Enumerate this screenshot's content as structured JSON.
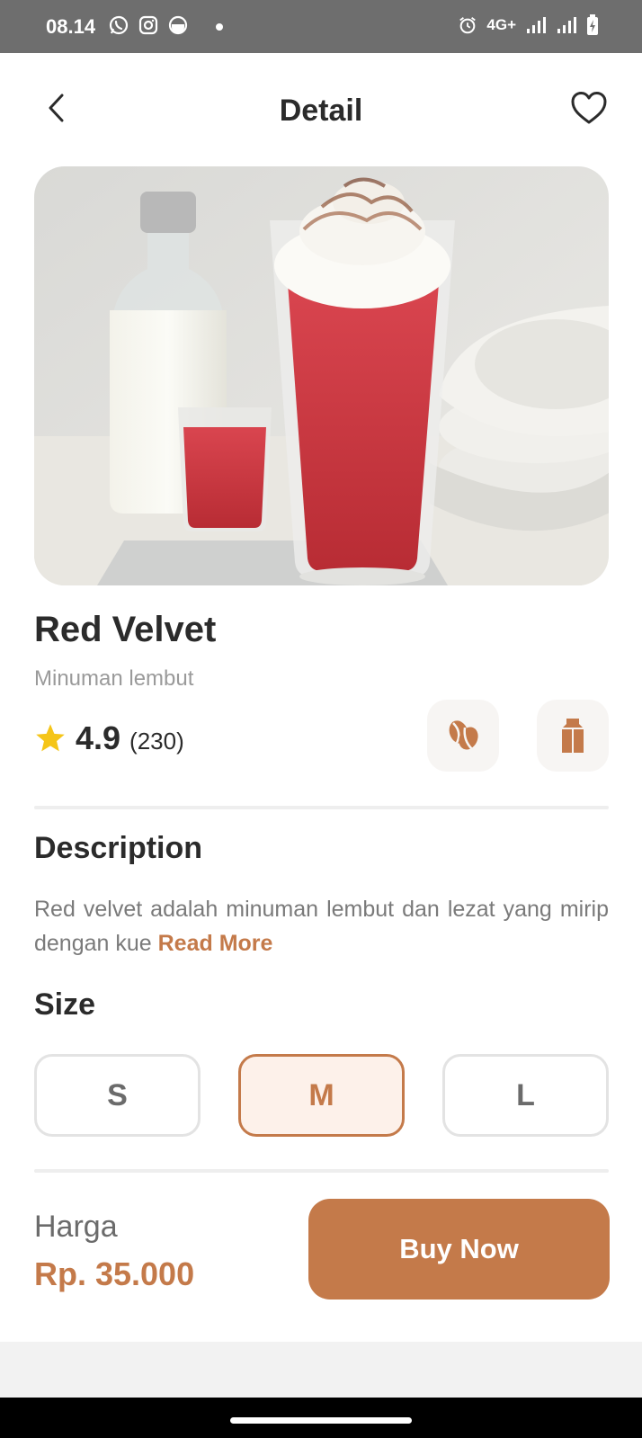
{
  "status_bar": {
    "time": "08.14",
    "network": "4G+",
    "app_icons": [
      "whatsapp-icon",
      "instagram-icon",
      "messenger-icon"
    ],
    "system_icons": [
      "alarm-icon",
      "signal-icon",
      "signal-icon",
      "battery-icon"
    ]
  },
  "header": {
    "title": "Detail",
    "back_icon": "chevron-left-icon",
    "favorite_icon": "heart-outline-icon"
  },
  "product": {
    "name": "Red Velvet",
    "subtitle": "Minuman lembut",
    "rating": "4.9",
    "rating_count": "(230)",
    "features": [
      "coffee-bean-icon",
      "milk-carton-icon"
    ]
  },
  "description": {
    "title": "Description",
    "text": "Red velvet adalah minuman lembut dan lezat yang mirip dengan kue ",
    "read_more": "Read More"
  },
  "size": {
    "title": "Size",
    "options": [
      "S",
      "M",
      "L"
    ],
    "selected": "M"
  },
  "footer": {
    "price_label": "Harga",
    "price": "Rp. 35.000",
    "buy_label": "Buy Now"
  },
  "colors": {
    "accent": "#C47A4A",
    "selected_bg": "#FDF1EA",
    "status_bar": "#6E6E6E",
    "star": "#F5C518"
  }
}
